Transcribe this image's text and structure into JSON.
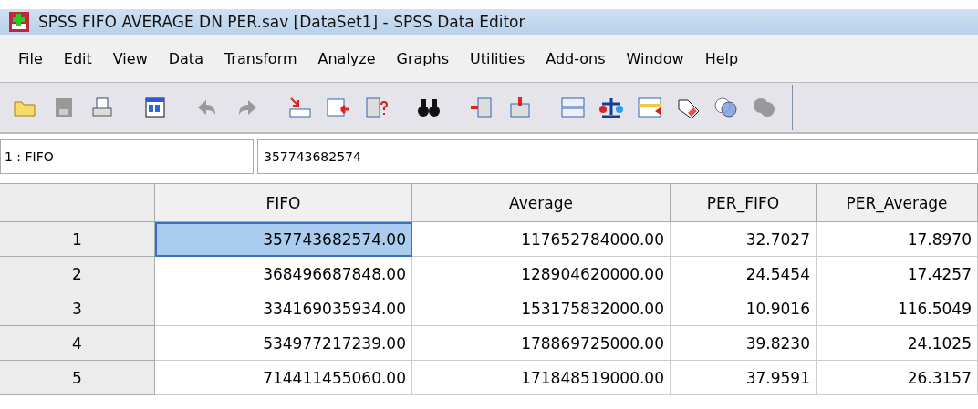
{
  "window": {
    "title": "SPSS FIFO AVERAGE DN PER.sav [DataSet1] - SPSS Data Editor"
  },
  "menu": [
    {
      "label": "File"
    },
    {
      "label": "Edit"
    },
    {
      "label": "View"
    },
    {
      "label": "Data"
    },
    {
      "label": "Transform"
    },
    {
      "label": "Analyze"
    },
    {
      "label": "Graphs"
    },
    {
      "label": "Utilities"
    },
    {
      "label": "Add-ons"
    },
    {
      "label": "Window"
    },
    {
      "label": "Help"
    }
  ],
  "cell_ref": {
    "name": "1 : FIFO",
    "value": "357743682574"
  },
  "table": {
    "columns": [
      "FIFO",
      "Average",
      "PER_FIFO",
      "PER_Average"
    ],
    "rows": [
      {
        "label": "1",
        "cells": [
          {
            "text": "357743682574.00",
            "selected": true
          },
          {
            "text": "117652784000.00",
            "selected": false
          },
          {
            "text": "32.7027",
            "selected": false
          },
          {
            "text": "17.8970",
            "selected": false
          }
        ]
      },
      {
        "label": "2",
        "cells": [
          {
            "text": "368496687848.00",
            "selected": false
          },
          {
            "text": "128904620000.00",
            "selected": false
          },
          {
            "text": "24.5454",
            "selected": false
          },
          {
            "text": "17.4257",
            "selected": false
          }
        ]
      },
      {
        "label": "3",
        "cells": [
          {
            "text": "334169035934.00",
            "selected": false
          },
          {
            "text": "153175832000.00",
            "selected": false
          },
          {
            "text": "10.9016",
            "selected": false
          },
          {
            "text": "116.5049",
            "selected": false
          }
        ]
      },
      {
        "label": "4",
        "cells": [
          {
            "text": "534977217239.00",
            "selected": false
          },
          {
            "text": "178869725000.00",
            "selected": false
          },
          {
            "text": "39.8230",
            "selected": false
          },
          {
            "text": "24.1025",
            "selected": false
          }
        ]
      },
      {
        "label": "5",
        "cells": [
          {
            "text": "714411455060.00",
            "selected": false
          },
          {
            "text": "171848519000.00",
            "selected": false
          },
          {
            "text": "37.9591",
            "selected": false
          },
          {
            "text": "26.3157",
            "selected": false
          }
        ]
      }
    ]
  }
}
